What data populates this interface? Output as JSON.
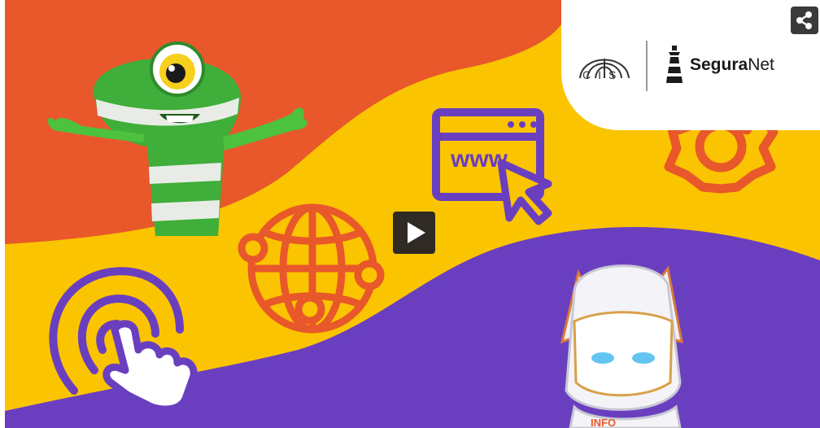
{
  "video": {
    "play_label": "Play",
    "share_label": "Share"
  },
  "brand": {
    "partner_logo": "CIS",
    "segura_bold": "Segura",
    "segura_regular": "Net"
  },
  "illustration": {
    "icons": [
      "browser-www-icon",
      "cursor-pointer-icon",
      "globe-icon",
      "gear-icon",
      "tap-hand-icon"
    ],
    "browser_text": "www",
    "characters": [
      "green-mascot",
      "robot-mascot"
    ],
    "robot_chest_text": "INFO"
  },
  "colors": {
    "orange": "#e8582a",
    "yellow": "#fbc400",
    "purple": "#6a3fbf",
    "accent_orange": "#e8582a",
    "accent_purple": "#6a3fbf"
  }
}
